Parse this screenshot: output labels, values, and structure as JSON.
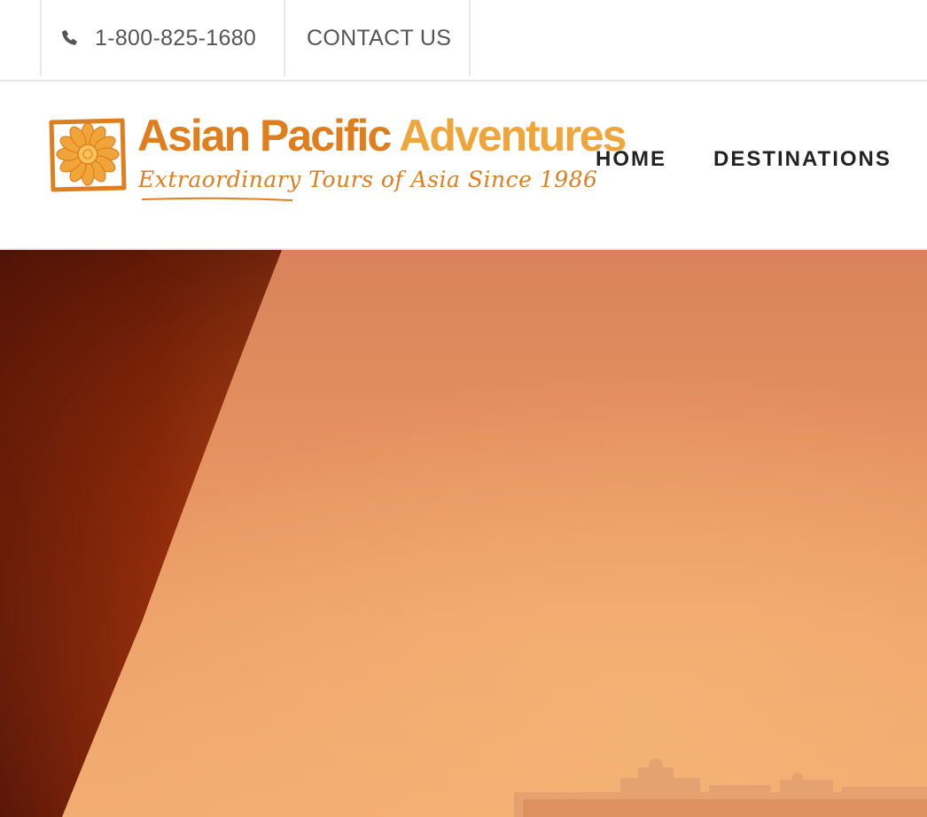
{
  "topbar": {
    "phone_icon": "phone-icon",
    "phone": "1-800-825-1680",
    "contact_label": "CONTACT US"
  },
  "header": {
    "logo": {
      "title_part1": "Asian Pacific",
      "title_part2": "Adventures",
      "tagline": "Extraordinary Tours of Asia Since 1986",
      "icon": "flower-icon"
    },
    "nav": [
      {
        "label": "HOME"
      },
      {
        "label": "DESTINATIONS"
      }
    ]
  },
  "colors": {
    "brand_orange": "#e07d1c",
    "brand_light_orange": "#f0a53a",
    "hero_sky": "#e38f5f"
  }
}
